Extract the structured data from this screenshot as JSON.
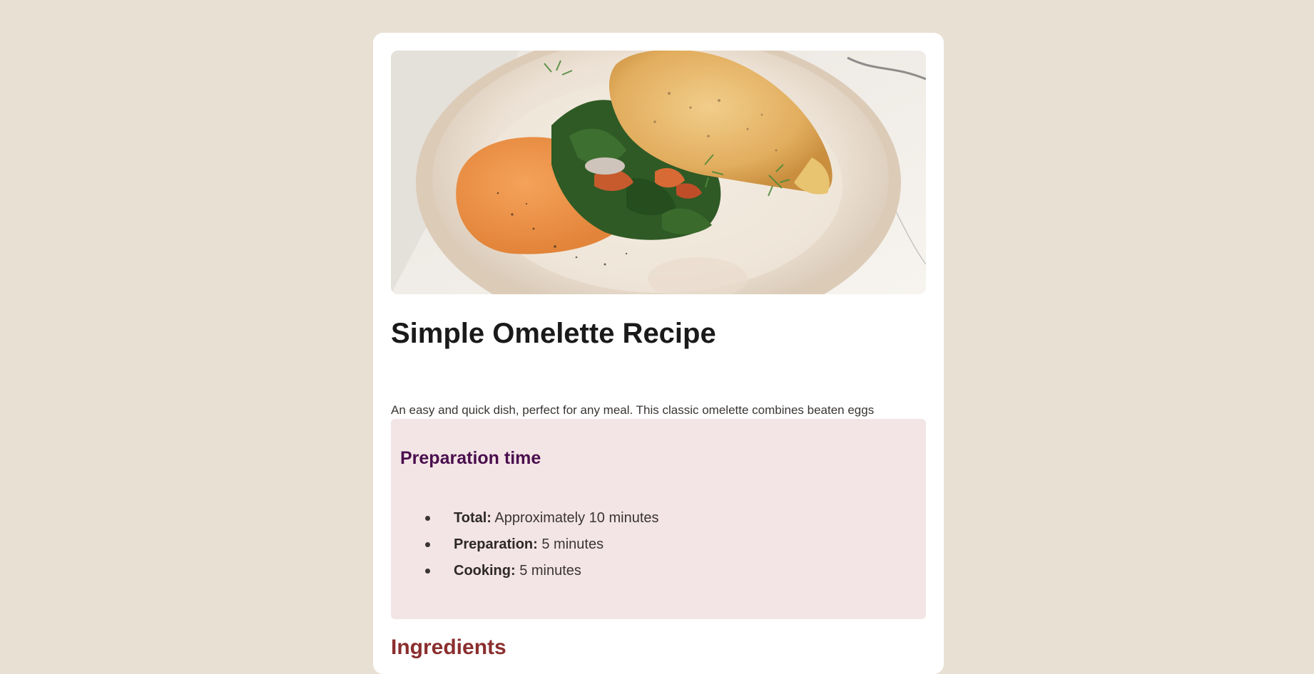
{
  "hero_image": {
    "alt": "",
    "icon": "omelette-photo"
  },
  "recipe": {
    "title": "Simple Omelette Recipe",
    "description": "An easy and quick dish, perfect for any meal. This classic omelette combines beaten eggs cooked to perfection, optionally filled with your choice of cheese, vegetables, or meats."
  },
  "prep": {
    "heading": "Preparation time",
    "items": [
      {
        "label": "Total:",
        "value": " Approximately 10 minutes"
      },
      {
        "label": "Preparation:",
        "value": " 5 minutes"
      },
      {
        "label": "Cooking:",
        "value": " 5 minutes"
      }
    ]
  },
  "ingredients": {
    "heading": "Ingredients"
  },
  "colors": {
    "page_bg": "#e8e0d3",
    "card_bg": "#ffffff",
    "prep_bg": "#f3e5e5",
    "prep_heading": "#4a0e4e",
    "section_heading": "#8b2e2e"
  }
}
